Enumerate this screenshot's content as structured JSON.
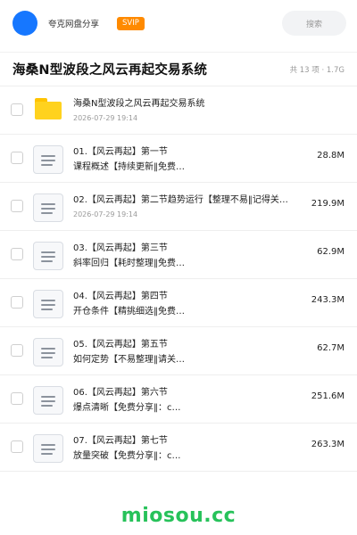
{
  "header": {
    "share_name": "夸克网盘分享",
    "vip_label": "SVIP",
    "search_label": "搜索",
    "avatar_color": "#1677ff",
    "vip_color": "#ff8a00"
  },
  "title_bar": {
    "title": "海桑N型波段之风云再起交易系统",
    "meta": "共 13 项 · 1.7G"
  },
  "items": [
    {
      "type": "folder",
      "name": "海桑N型波段之风云再起交易系统",
      "date": "2026-07-29 19:14",
      "size": ""
    },
    {
      "type": "file",
      "name": "01.【风云再起】第一节",
      "subtitle": "课程概述【持续更新‖免费…",
      "size": "28.8M"
    },
    {
      "type": "file",
      "name": "02.【风云再起】第二节趋势运行【整理不易‖记得关…",
      "date": "2026-07-29 19:14",
      "size": "219.9M"
    },
    {
      "type": "file",
      "name": "03.【风云再起】第三节",
      "subtitle": "斜率回归【耗时整理‖免费…",
      "size": "62.9M"
    },
    {
      "type": "file",
      "name": "04.【风云再起】第四节",
      "subtitle": "开仓条件【精挑细选‖免费…",
      "size": "243.3M"
    },
    {
      "type": "file",
      "name": "05.【风云再起】第五节",
      "subtitle": "如何定势【不易整理‖请关…",
      "size": "62.7M"
    },
    {
      "type": "file",
      "name": "06.【风云再起】第六节",
      "subtitle": "爆点清晰【免费分享‖：c…",
      "size": "251.6M"
    },
    {
      "type": "file",
      "name": "07.【风云再起】第七节",
      "subtitle": "放量突破【免费分享‖：c…",
      "size": "263.3M"
    }
  ],
  "watermark": {
    "text": "miosou.cc",
    "color": "#27c25a"
  },
  "colors": {
    "folder": "#ffd21e",
    "file_icon_border": "#d9dde3"
  }
}
